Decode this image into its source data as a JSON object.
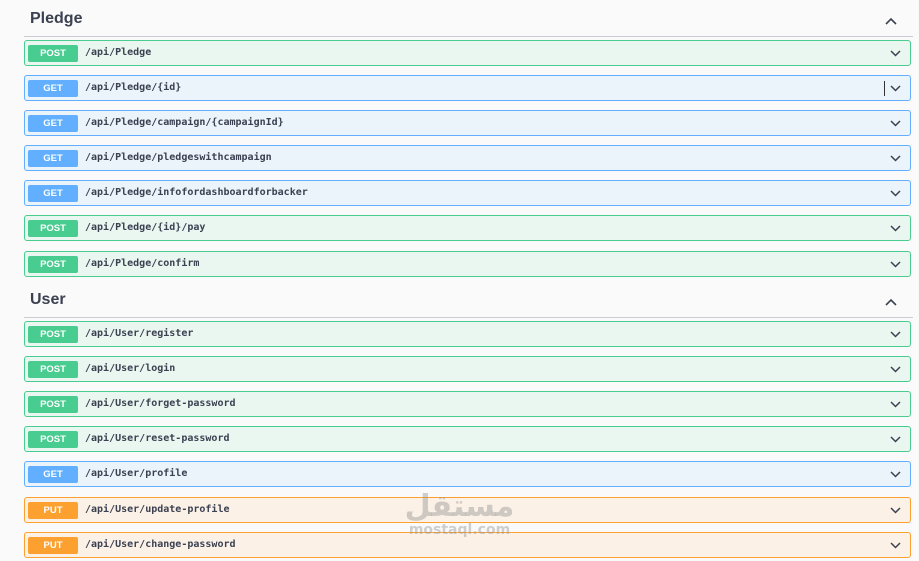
{
  "sections": [
    {
      "title": "Pledge",
      "operations": [
        {
          "method": "POST",
          "path": "/api/Pledge"
        },
        {
          "method": "GET",
          "path": "/api/Pledge/{id}"
        },
        {
          "method": "GET",
          "path": "/api/Pledge/campaign/{campaignId}"
        },
        {
          "method": "GET",
          "path": "/api/Pledge/pledgeswithcampaign"
        },
        {
          "method": "GET",
          "path": "/api/Pledge/infofordashboardforbacker"
        },
        {
          "method": "POST",
          "path": "/api/Pledge/{id}/pay"
        },
        {
          "method": "POST",
          "path": "/api/Pledge/confirm"
        }
      ]
    },
    {
      "title": "User",
      "operations": [
        {
          "method": "POST",
          "path": "/api/User/register"
        },
        {
          "method": "POST",
          "path": "/api/User/login"
        },
        {
          "method": "POST",
          "path": "/api/User/forget-password"
        },
        {
          "method": "POST",
          "path": "/api/User/reset-password"
        },
        {
          "method": "GET",
          "path": "/api/User/profile"
        },
        {
          "method": "PUT",
          "path": "/api/User/update-profile"
        },
        {
          "method": "PUT",
          "path": "/api/User/change-password"
        }
      ]
    }
  ],
  "watermark": {
    "arabic": "مستقل",
    "latin": "mostaql.com"
  },
  "colors": {
    "post": "#49cc90",
    "get": "#61affe",
    "put": "#fca130",
    "text": "#3b4151"
  },
  "icons": {
    "collapse": "chevron-up-icon",
    "expand": "chevron-down-icon"
  }
}
